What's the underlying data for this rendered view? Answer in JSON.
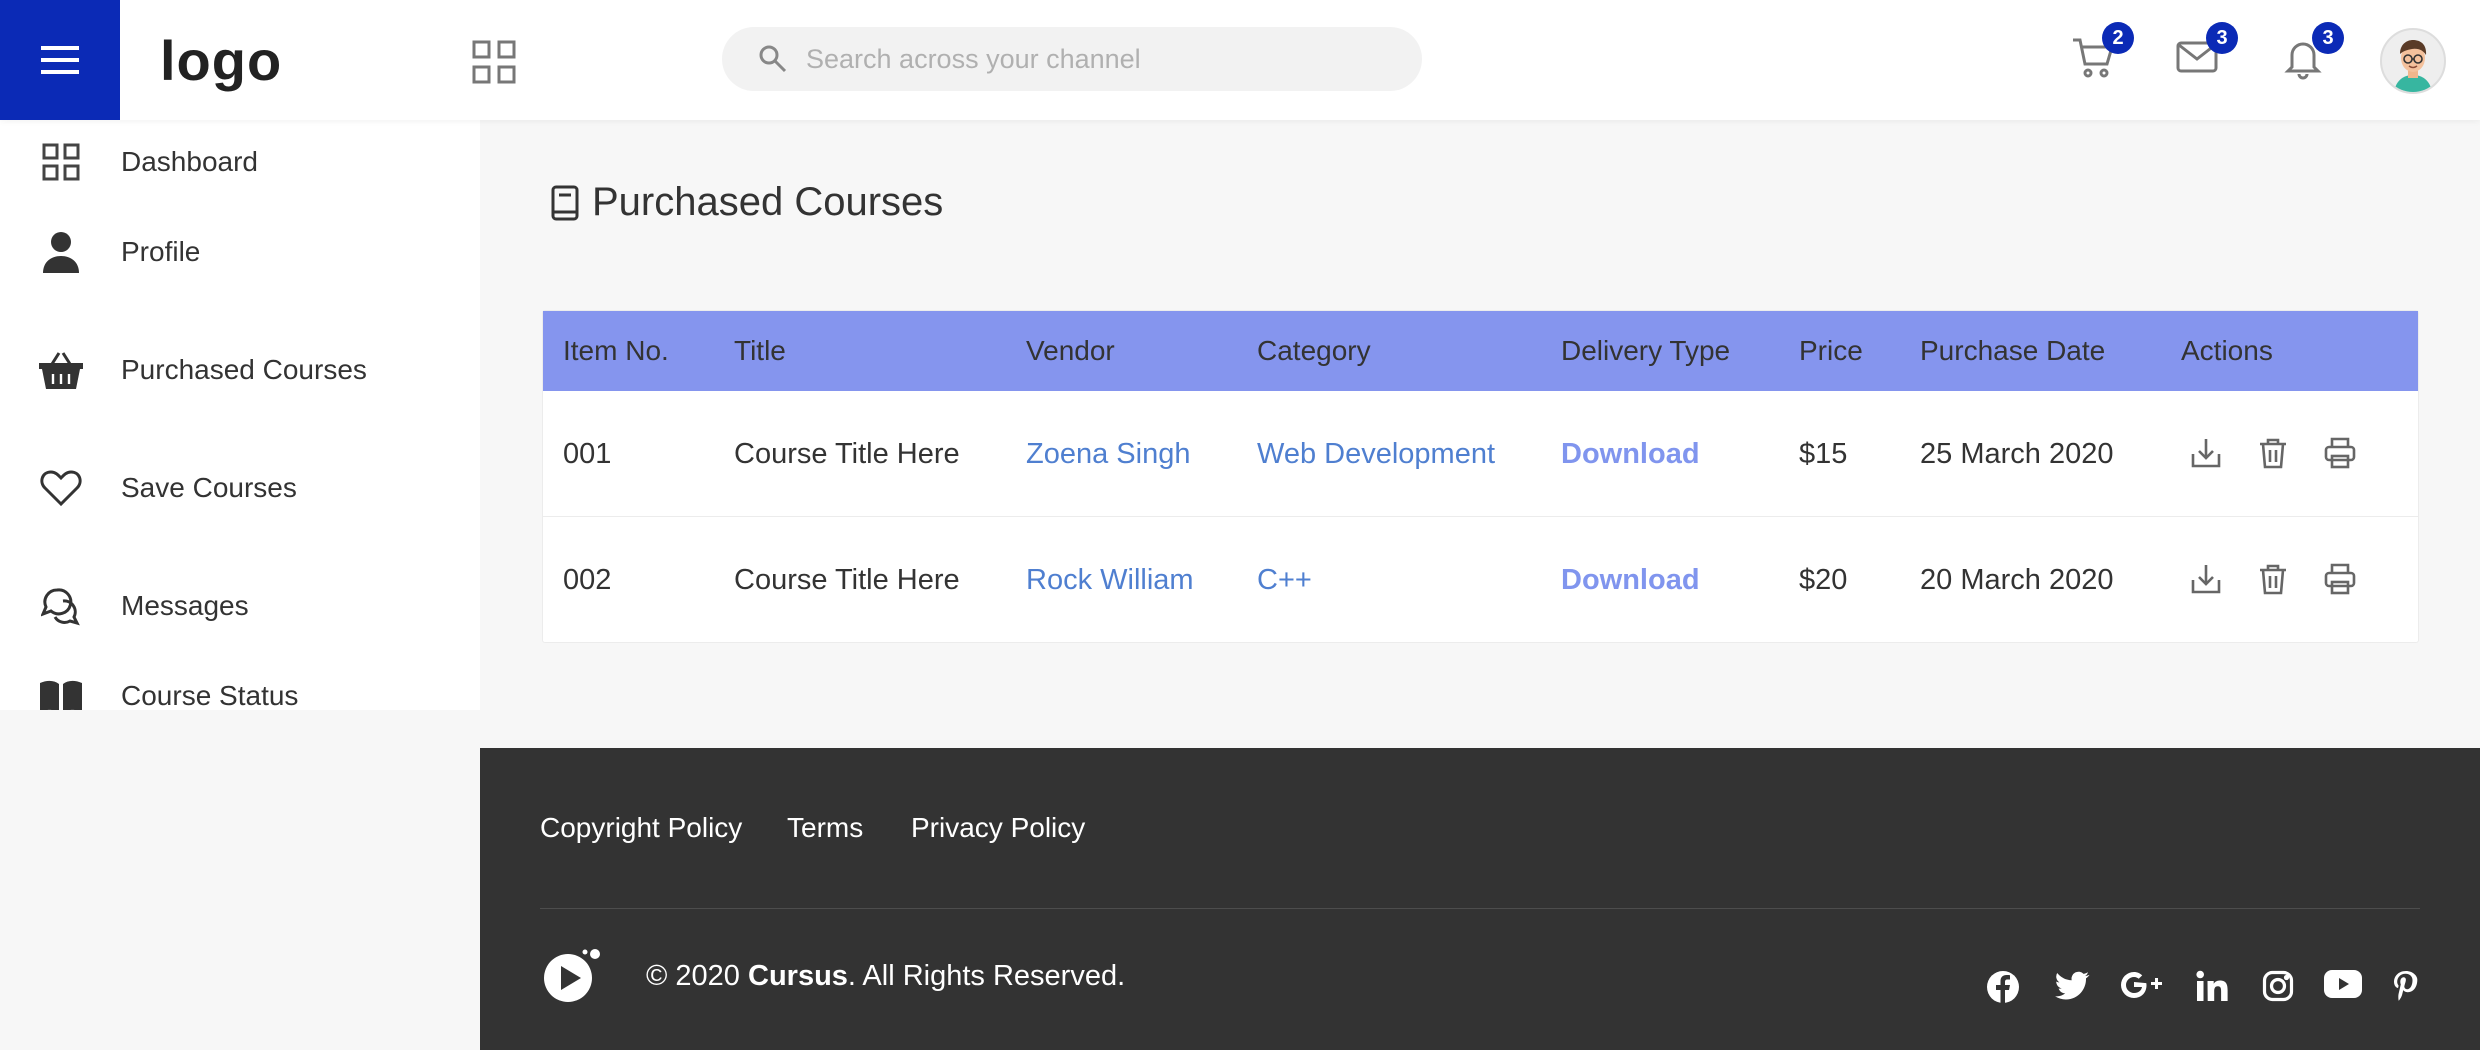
{
  "header": {
    "logo": "logo",
    "search_placeholder": "Search across your channel",
    "cart_count": "2",
    "mail_count": "3",
    "notification_count": "3",
    "accent_color": "#0b2ab6",
    "icons": [
      "menu-icon",
      "apps-icon",
      "search-icon",
      "cart-icon",
      "mail-icon",
      "bell-icon",
      "avatar"
    ]
  },
  "sidebar": {
    "items": [
      {
        "label": "Dashboard",
        "icon": "dashboard-icon"
      },
      {
        "label": "Profile",
        "icon": "user-icon"
      },
      {
        "label": "Purchased Courses",
        "icon": "basket-icon"
      },
      {
        "label": "Save Courses",
        "icon": "heart-icon"
      },
      {
        "label": "Messages",
        "icon": "chat-icon"
      },
      {
        "label": "Course Status",
        "icon": "book-icon"
      }
    ]
  },
  "main": {
    "title": "Purchased Courses",
    "title_icon": "book-icon",
    "table": {
      "header_color": "#8595ee",
      "columns": [
        "Item No.",
        "Title",
        "Vendor",
        "Category",
        "Delivery Type",
        "Price",
        "Purchase Date",
        "Actions"
      ],
      "rows": [
        {
          "item_no": "001",
          "title": "Course Title Here",
          "vendor": "Zoena Singh",
          "category": "Web Development",
          "delivery": "Download",
          "price": "$15",
          "date": "25 March 2020"
        },
        {
          "item_no": "002",
          "title": "Course Title Here",
          "vendor": "Rock William",
          "category": "C++",
          "delivery": "Download",
          "price": "$20",
          "date": "20 March 2020"
        }
      ],
      "row_actions": [
        "download-icon",
        "trash-icon",
        "print-icon"
      ]
    }
  },
  "footer": {
    "links": [
      "Copyright Policy",
      "Terms",
      "Privacy Policy"
    ],
    "copyright_prefix": "© 2020 ",
    "brand": "Cursus",
    "copyright_suffix": ". All Rights Reserved.",
    "social": [
      "facebook-icon",
      "twitter-icon",
      "google-plus-icon",
      "linkedin-icon",
      "instagram-icon",
      "youtube-icon",
      "pinterest-icon"
    ]
  }
}
